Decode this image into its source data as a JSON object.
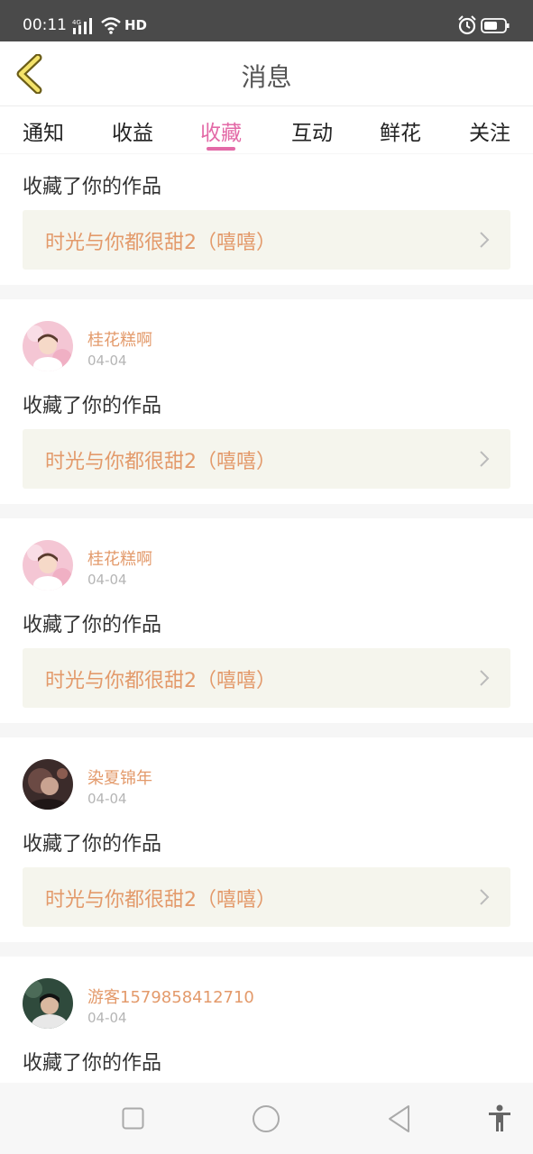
{
  "status_bar": {
    "time": "00:11",
    "network": "4G",
    "hd": "HD",
    "icons": [
      "signal-icon",
      "wifi-icon",
      "alarm-icon",
      "battery-icon"
    ]
  },
  "header": {
    "title": "消息",
    "back_icon": "chevron-left-icon"
  },
  "tabs": [
    {
      "label": "通知",
      "active": false
    },
    {
      "label": "收益",
      "active": false
    },
    {
      "label": "收藏",
      "active": true
    },
    {
      "label": "互动",
      "active": false
    },
    {
      "label": "鲜花",
      "active": false
    },
    {
      "label": "关注",
      "active": false
    }
  ],
  "notifications": [
    {
      "user": "",
      "date": "",
      "action": "收藏了你的作品",
      "work": "时光与你都很甜2（嘻嘻）"
    },
    {
      "user": "桂花糕啊",
      "date": "04-04",
      "action": "收藏了你的作品",
      "work": "时光与你都很甜2（嘻嘻）"
    },
    {
      "user": "桂花糕啊",
      "date": "04-04",
      "action": "收藏了你的作品",
      "work": "时光与你都很甜2（嘻嘻）"
    },
    {
      "user": "染夏锦年",
      "date": "04-04",
      "action": "收藏了你的作品",
      "work": "时光与你都很甜2（嘻嘻）"
    },
    {
      "user": "游客1579858412710",
      "date": "04-04",
      "action": "收藏了你的作品",
      "work": ""
    }
  ],
  "nav_bar": {
    "icons": [
      "recents-square-icon",
      "home-circle-icon",
      "back-triangle-icon",
      "accessibility-icon"
    ]
  },
  "colors": {
    "accent": "#e36aa7",
    "name_orange": "#e39a6b",
    "work_bg": "#f5f5ed",
    "status_bar_bg": "#4a4a4a"
  }
}
